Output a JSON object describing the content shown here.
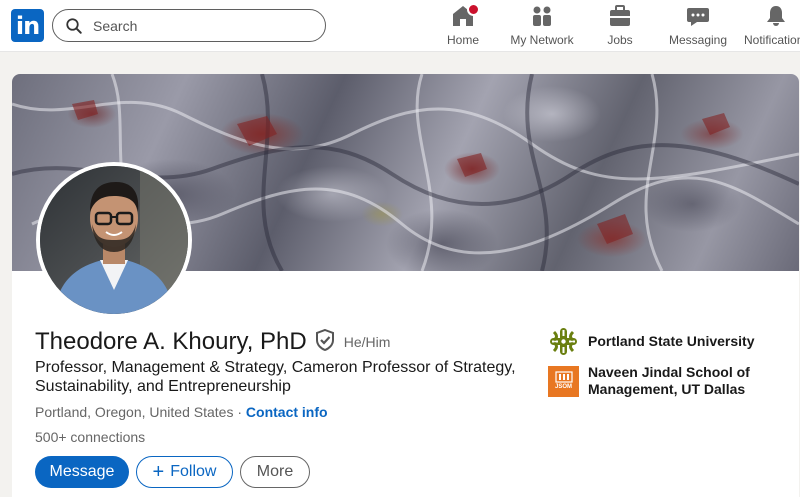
{
  "nav": {
    "logo_text": "in",
    "search_placeholder": "Search",
    "items": [
      {
        "label": "Home",
        "icon": "home-icon"
      },
      {
        "label": "My Network",
        "icon": "network-icon"
      },
      {
        "label": "Jobs",
        "icon": "briefcase-icon"
      },
      {
        "label": "Messaging",
        "icon": "messaging-icon"
      },
      {
        "label": "Notifications",
        "icon": "bell-icon"
      }
    ]
  },
  "profile": {
    "name": "Theodore A. Khoury, PhD",
    "pronouns": "He/Him",
    "headline": "Professor, Management & Strategy, Cameron Professor of Strategy, Sustainability, and Entrepreneurship",
    "location": "Portland, Oregon, United States",
    "separator": " · ",
    "contact_label": "Contact info",
    "connections": "500+ connections",
    "organizations": [
      {
        "name": "Portland State University",
        "logo": "psu-logo"
      },
      {
        "name": "Naveen Jindal School of Management, UT Dallas",
        "logo": "jsom-logo",
        "logo_text": "JSOM"
      }
    ]
  },
  "actions": {
    "message_label": "Message",
    "follow_label": "Follow",
    "more_label": "More"
  },
  "colors": {
    "brand": "#0a66c2",
    "notification": "#cb112d",
    "psu_green": "#6a7f10",
    "jsom_orange": "#e87722"
  }
}
